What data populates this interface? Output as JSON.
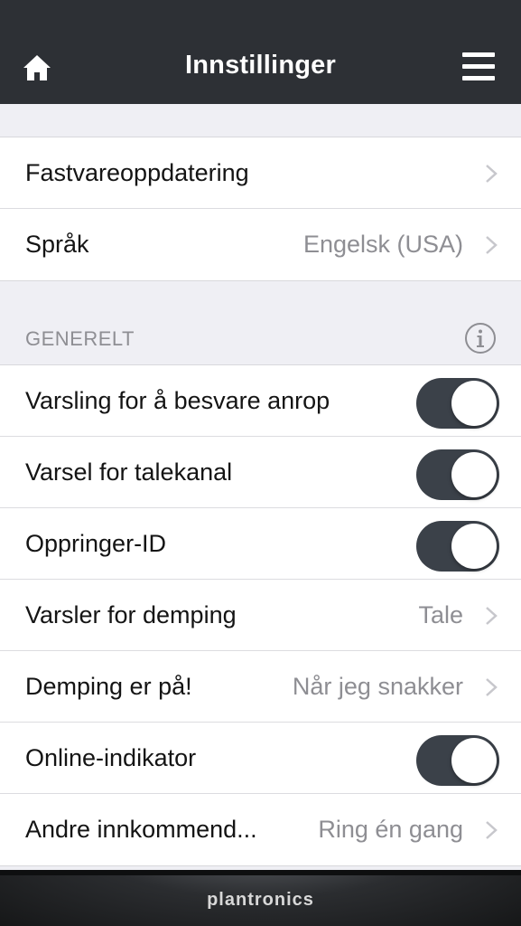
{
  "header": {
    "title": "Innstillinger",
    "home_icon": "home-icon",
    "menu_icon": "hamburger-menu-icon"
  },
  "top_group": [
    {
      "label": "Fastvareoppdatering",
      "value": ""
    },
    {
      "label": "Språk",
      "value": "Engelsk (USA)"
    }
  ],
  "general": {
    "title": "GENERELT",
    "info_icon": "info-icon",
    "rows": [
      {
        "label": "Varsling for å besvare anrop",
        "type": "toggle",
        "on": true
      },
      {
        "label": "Varsel for talekanal",
        "type": "toggle",
        "on": true
      },
      {
        "label": "Oppringer-ID",
        "type": "toggle",
        "on": true
      },
      {
        "label": "Varsler for demping",
        "type": "link",
        "value": "Tale"
      },
      {
        "label": "Demping er på!",
        "type": "link",
        "value": "Når jeg snakker"
      },
      {
        "label": "Online-indikator",
        "type": "toggle",
        "on": true
      },
      {
        "label": "Andre innkommend...",
        "type": "link",
        "value": "Ring én gang"
      }
    ]
  },
  "footer": {
    "brand": "plantronics"
  },
  "colors": {
    "navbar": "#2d3035",
    "toggle_on": "#3b4149",
    "background": "#efeff4"
  }
}
